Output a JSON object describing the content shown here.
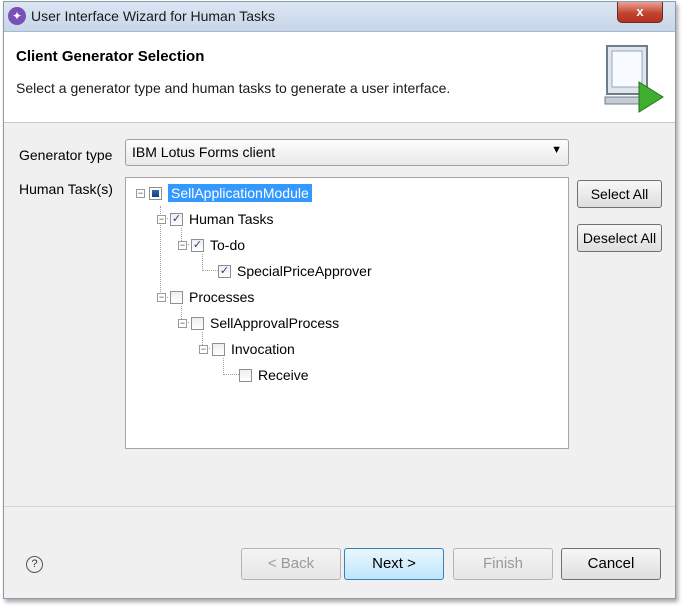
{
  "window": {
    "title": "User Interface Wizard for Human Tasks",
    "close_label": "x"
  },
  "header": {
    "title": "Client Generator Selection",
    "description": "Select a generator type and human tasks to generate a user interface."
  },
  "generator": {
    "label": "Generator type",
    "value": "IBM Lotus Forms client"
  },
  "tasks": {
    "label": "Human Task(s)",
    "tree": [
      {
        "label": "SellApplicationModule",
        "checked": "indeterminate",
        "selected": true
      },
      {
        "label": "Human Tasks",
        "checked": true
      },
      {
        "label": "To-do",
        "checked": true
      },
      {
        "label": "SpecialPriceApprover",
        "checked": true
      },
      {
        "label": "Processes",
        "checked": false
      },
      {
        "label": "SellApprovalProcess",
        "checked": false
      },
      {
        "label": "Invocation",
        "checked": false
      },
      {
        "label": "Receive",
        "checked": false
      }
    ]
  },
  "buttons": {
    "select_all": "Select All",
    "deselect_all": "Deselect All",
    "back": "< Back",
    "next": "Next >",
    "finish": "Finish",
    "cancel": "Cancel"
  },
  "help": "?"
}
